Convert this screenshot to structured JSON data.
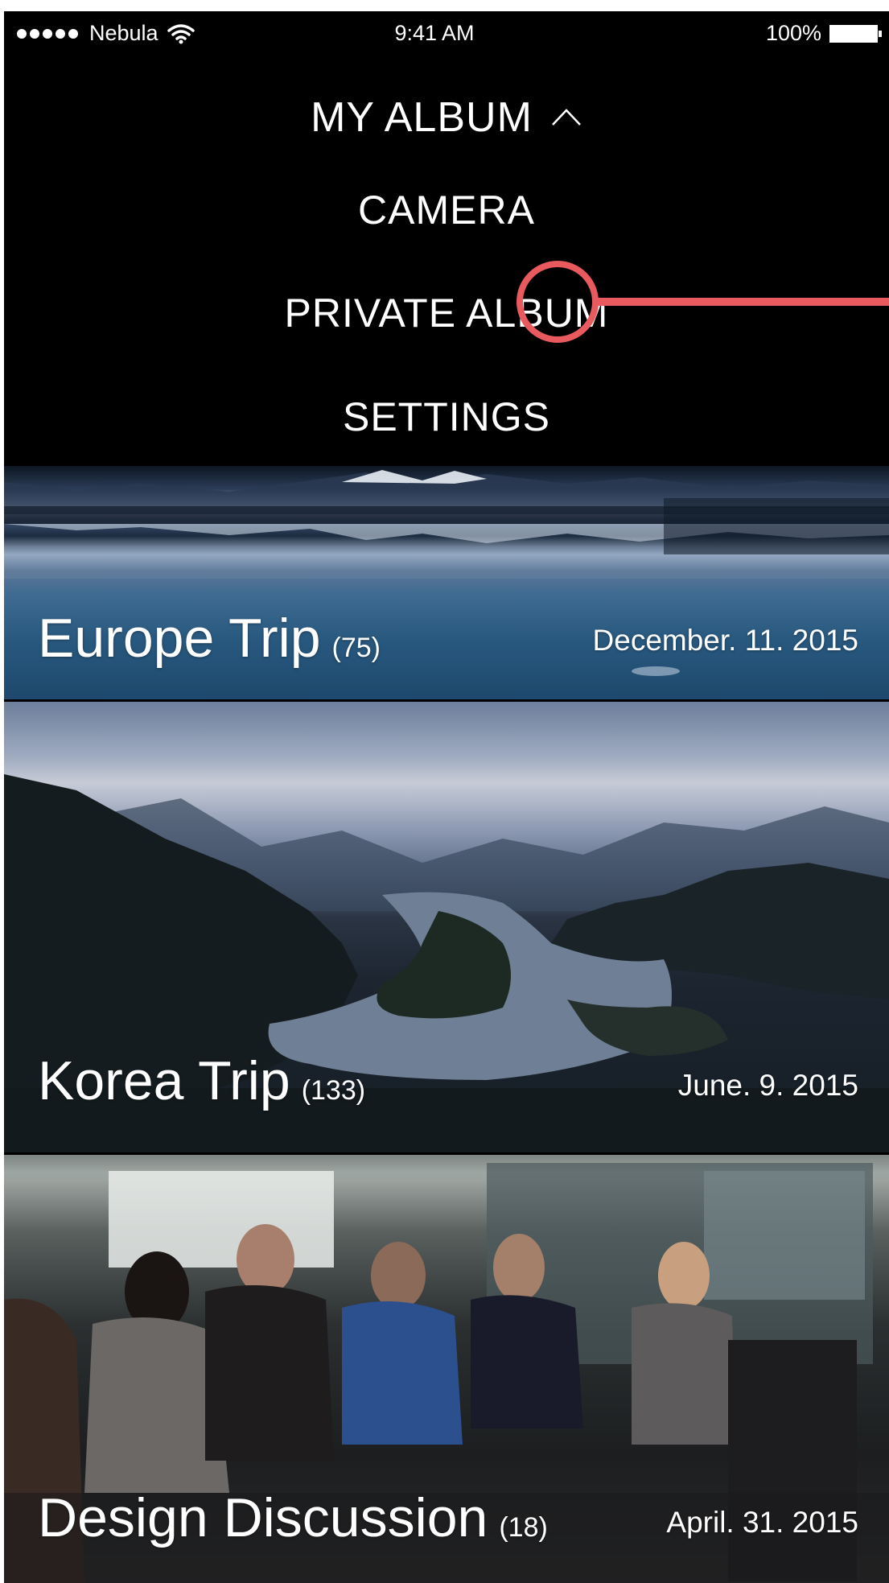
{
  "status_bar": {
    "carrier": "Nebula",
    "time": "9:41 AM",
    "battery": "100%"
  },
  "menu": {
    "title": "MY ALBUM",
    "items": [
      {
        "label": "CAMERA"
      },
      {
        "label": "PRIVATE ALBUM"
      },
      {
        "label": "SETTINGS"
      }
    ],
    "indicator_color": "#e85a5d"
  },
  "albums": [
    {
      "title": "Europe Trip",
      "count": "(75)",
      "date": "December. 11. 2015"
    },
    {
      "title": "Korea Trip",
      "count": "(133)",
      "date": "June. 9. 2015"
    },
    {
      "title": "Design Discussion",
      "count": "(18)",
      "date": "April. 31. 2015"
    }
  ]
}
